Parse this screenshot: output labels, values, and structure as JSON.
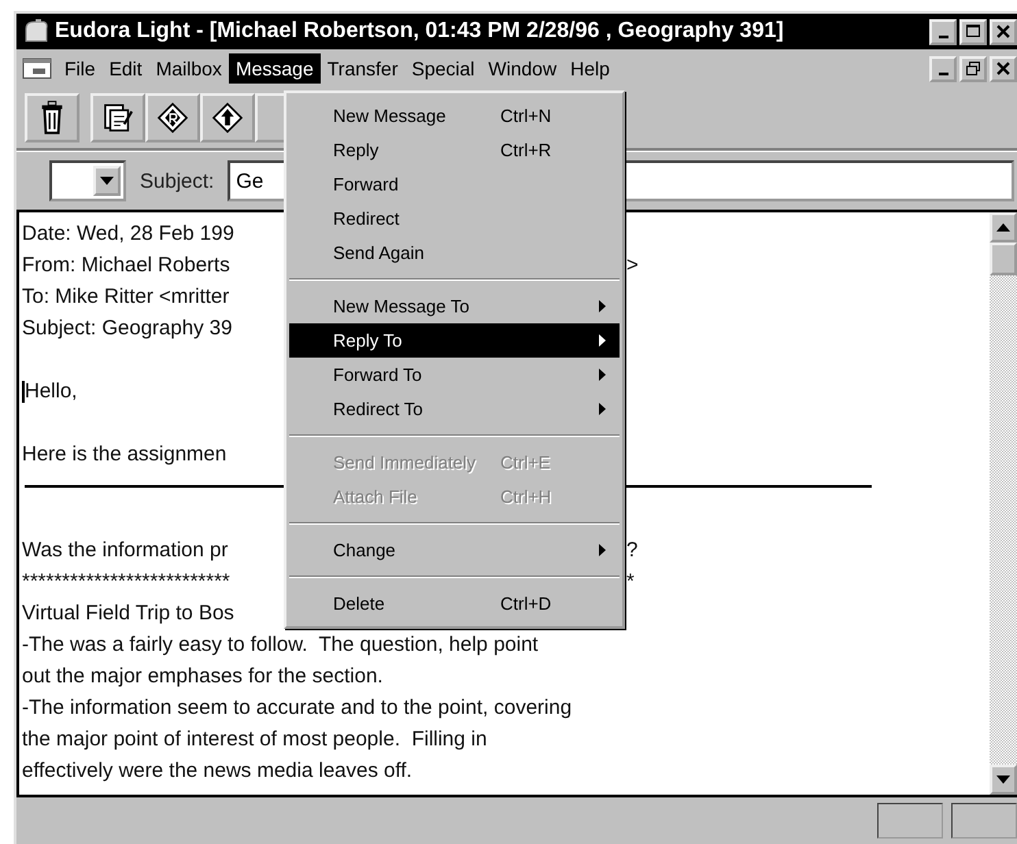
{
  "window": {
    "title": "Eudora Light - [Michael Robertson, 01:43 PM 2/28/96 , Geography 391]"
  },
  "menu_bar": [
    {
      "label": "File",
      "selected": false
    },
    {
      "label": "Edit",
      "selected": false
    },
    {
      "label": "Mailbox",
      "selected": false
    },
    {
      "label": "Message",
      "selected": true
    },
    {
      "label": "Transfer",
      "selected": false
    },
    {
      "label": "Special",
      "selected": false
    },
    {
      "label": "Window",
      "selected": false
    },
    {
      "label": "Help",
      "selected": false
    }
  ],
  "subject": {
    "label": "Subject:",
    "value": "Ge"
  },
  "message_menu": [
    {
      "kind": "item",
      "label": "New Message",
      "shortcut": "Ctrl+N",
      "disabled": false,
      "selected": false,
      "submenu": false
    },
    {
      "kind": "item",
      "label": "Reply",
      "shortcut": "Ctrl+R",
      "disabled": false,
      "selected": false,
      "submenu": false
    },
    {
      "kind": "item",
      "label": "Forward",
      "disabled": false,
      "selected": false,
      "submenu": false
    },
    {
      "kind": "item",
      "label": "Redirect",
      "disabled": false,
      "selected": false,
      "submenu": false
    },
    {
      "kind": "item",
      "label": "Send Again",
      "disabled": false,
      "selected": false,
      "submenu": false
    },
    {
      "kind": "separator"
    },
    {
      "kind": "item",
      "label": "New Message To",
      "disabled": false,
      "selected": false,
      "submenu": true
    },
    {
      "kind": "item",
      "label": "Reply To",
      "disabled": false,
      "selected": true,
      "submenu": true
    },
    {
      "kind": "item",
      "label": "Forward To",
      "disabled": false,
      "selected": false,
      "submenu": true
    },
    {
      "kind": "item",
      "label": "Redirect To",
      "disabled": false,
      "selected": false,
      "submenu": true
    },
    {
      "kind": "separator"
    },
    {
      "kind": "item",
      "label": "Send Immediately",
      "shortcut": "Ctrl+E",
      "disabled": true,
      "selected": false,
      "submenu": false
    },
    {
      "kind": "item",
      "label": "Attach File",
      "shortcut": "Ctrl+H",
      "disabled": true,
      "selected": false,
      "submenu": false
    },
    {
      "kind": "separator"
    },
    {
      "kind": "item",
      "label": "Change",
      "disabled": false,
      "selected": false,
      "submenu": true
    },
    {
      "kind": "separator"
    },
    {
      "kind": "item",
      "label": "Delete",
      "shortcut": "Ctrl+D",
      "disabled": false,
      "selected": false,
      "submenu": false
    }
  ],
  "body": [
    {
      "kind": "text",
      "text": "Date: Wed, 28 Feb 199"
    },
    {
      "kind": "text",
      "text": "From: Michael Roberts",
      "tail": ">"
    },
    {
      "kind": "text",
      "text": "To: Mike Ritter <mritter"
    },
    {
      "kind": "text",
      "text": "Subject: Geography 39"
    },
    {
      "kind": "blank"
    },
    {
      "kind": "text",
      "text": "Hello,",
      "caret": true
    },
    {
      "kind": "blank"
    },
    {
      "kind": "text",
      "text": "Here is the assignmen"
    },
    {
      "kind": "rule"
    },
    {
      "kind": "blank"
    },
    {
      "kind": "text",
      "text": "Was the information pr",
      "tail": "?"
    },
    {
      "kind": "text",
      "text": "**************************",
      "tail": "*"
    },
    {
      "kind": "text",
      "text": "Virtual Field Trip to Bos"
    },
    {
      "kind": "text",
      "text": "-The was a fairly easy to follow.  The question, help point"
    },
    {
      "kind": "text",
      "text": "out the major emphases for the section."
    },
    {
      "kind": "text",
      "text": "-The information seem to accurate and to the point, covering"
    },
    {
      "kind": "text",
      "text": "the major point of interest of most people.  Filling in"
    },
    {
      "kind": "text",
      "text": "effectively were the news media leaves off."
    }
  ]
}
